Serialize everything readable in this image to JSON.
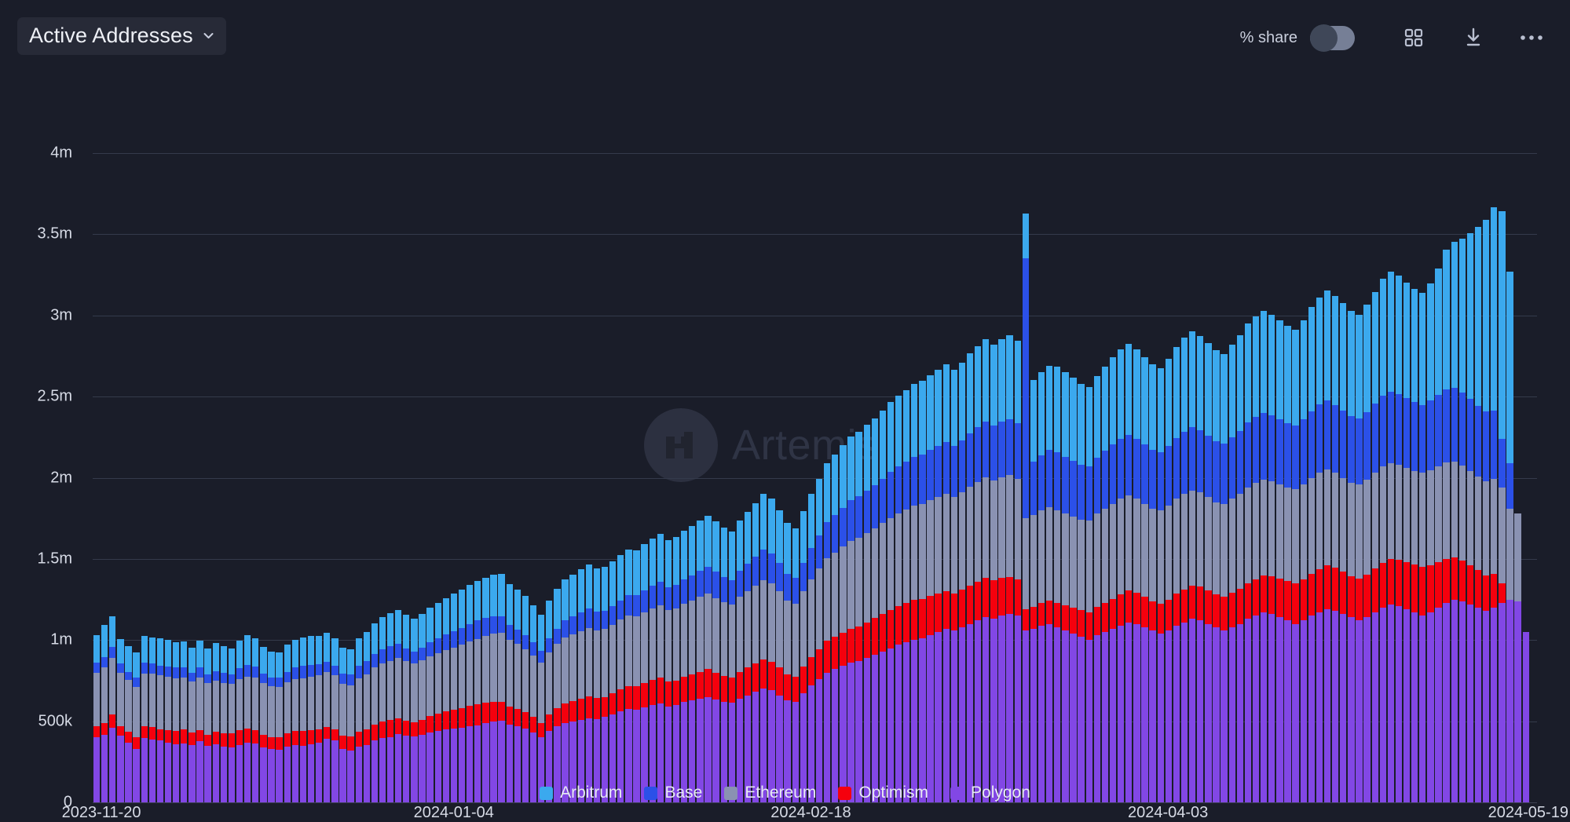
{
  "header": {
    "title": "Active Addresses",
    "dropdown_icon": "chevron-down-icon",
    "share_label": "% share",
    "toggle_state": "off",
    "grid_icon": "grid-view-icon",
    "download_icon": "download-icon",
    "more_icon": "more-options-icon"
  },
  "watermark": {
    "text": "Artemis"
  },
  "colors": {
    "background": "#1a1d29",
    "grid": "#343a4b",
    "text": "#d7dbe6",
    "Arbitrum": "#3ba9ee",
    "Base": "#2b50e8",
    "Ethereum": "#8a92b2",
    "Optimism": "#f5000d",
    "Polygon": "#8247e5"
  },
  "chart_data": {
    "type": "bar",
    "stacked": true,
    "title": "Active Addresses",
    "xlabel": "",
    "ylabel": "",
    "ylim": [
      0,
      4000000
    ],
    "grid": true,
    "legend_position": "bottom",
    "ytick_labels": [
      "0",
      "500k",
      "1m",
      "1.5m",
      "2m",
      "2.5m",
      "3m",
      "3.5m",
      "4m"
    ],
    "ytick_values": [
      0,
      500000,
      1000000,
      1500000,
      2000000,
      2500000,
      3000000,
      3500000,
      4000000
    ],
    "xtick_labels": [
      "2023-11-20",
      "2024-01-04",
      "2024-02-18",
      "2024-04-03",
      "2024-05-19"
    ],
    "xtick_indices": [
      0,
      45,
      90,
      135,
      181
    ],
    "x_start": "2023-11-20",
    "x_end": "2024-05-19",
    "n_points": 182,
    "series": [
      {
        "name": "Polygon",
        "color": "#8247e5",
        "values": [
          400000,
          415000,
          460000,
          410000,
          370000,
          330000,
          395000,
          385000,
          380000,
          370000,
          360000,
          365000,
          355000,
          375000,
          350000,
          360000,
          345000,
          340000,
          355000,
          370000,
          365000,
          340000,
          330000,
          325000,
          345000,
          355000,
          350000,
          360000,
          370000,
          390000,
          380000,
          330000,
          320000,
          345000,
          355000,
          380000,
          395000,
          400000,
          420000,
          410000,
          405000,
          415000,
          430000,
          440000,
          450000,
          455000,
          460000,
          470000,
          475000,
          490000,
          500000,
          505000,
          480000,
          470000,
          455000,
          430000,
          400000,
          440000,
          470000,
          490000,
          500000,
          510000,
          520000,
          515000,
          525000,
          540000,
          560000,
          575000,
          570000,
          585000,
          600000,
          610000,
          590000,
          600000,
          620000,
          630000,
          640000,
          650000,
          635000,
          620000,
          615000,
          640000,
          660000,
          680000,
          700000,
          690000,
          660000,
          630000,
          620000,
          670000,
          720000,
          760000,
          800000,
          820000,
          840000,
          860000,
          870000,
          890000,
          910000,
          930000,
          950000,
          970000,
          985000,
          1000000,
          1010000,
          1030000,
          1050000,
          1070000,
          1060000,
          1080000,
          1100000,
          1120000,
          1140000,
          1130000,
          1150000,
          1160000,
          1150000,
          1060000,
          1070000,
          1090000,
          1100000,
          1080000,
          1060000,
          1040000,
          1020000,
          1000000,
          1030000,
          1050000,
          1070000,
          1090000,
          1110000,
          1100000,
          1080000,
          1060000,
          1040000,
          1060000,
          1090000,
          1110000,
          1130000,
          1120000,
          1100000,
          1080000,
          1060000,
          1080000,
          1100000,
          1130000,
          1150000,
          1170000,
          1160000,
          1140000,
          1120000,
          1100000,
          1120000,
          1150000,
          1170000,
          1190000,
          1180000,
          1160000,
          1140000,
          1120000,
          1140000,
          1170000,
          1200000,
          1220000,
          1210000,
          1190000,
          1170000,
          1150000,
          1170000,
          1200000,
          1230000,
          1250000,
          1240000,
          1220000,
          1200000,
          1180000,
          1200000,
          1230000,
          1250000,
          1240000,
          1050000
        ]
      },
      {
        "name": "Optimism",
        "color": "#f5000d",
        "values": [
          70000,
          75000,
          80000,
          60000,
          65000,
          70000,
          75000,
          80000,
          70000,
          75000,
          80000,
          85000,
          75000,
          70000,
          65000,
          75000,
          80000,
          85000,
          90000,
          85000,
          80000,
          75000,
          70000,
          75000,
          80000,
          85000,
          90000,
          85000,
          80000,
          75000,
          70000,
          80000,
          85000,
          90000,
          95000,
          100000,
          105000,
          110000,
          100000,
          95000,
          90000,
          95000,
          100000,
          105000,
          110000,
          115000,
          120000,
          125000,
          130000,
          125000,
          120000,
          115000,
          110000,
          105000,
          100000,
          95000,
          90000,
          100000,
          110000,
          120000,
          125000,
          130000,
          135000,
          130000,
          125000,
          130000,
          135000,
          140000,
          145000,
          150000,
          155000,
          160000,
          155000,
          150000,
          155000,
          160000,
          165000,
          170000,
          165000,
          160000,
          155000,
          165000,
          170000,
          175000,
          180000,
          175000,
          170000,
          160000,
          155000,
          165000,
          175000,
          185000,
          195000,
          200000,
          205000,
          210000,
          215000,
          220000,
          225000,
          230000,
          235000,
          240000,
          245000,
          250000,
          245000,
          240000,
          235000,
          230000,
          225000,
          230000,
          235000,
          240000,
          245000,
          240000,
          235000,
          230000,
          225000,
          130000,
          135000,
          140000,
          145000,
          150000,
          155000,
          160000,
          165000,
          170000,
          175000,
          180000,
          185000,
          190000,
          195000,
          190000,
          185000,
          180000,
          185000,
          190000,
          195000,
          200000,
          205000,
          210000,
          205000,
          200000,
          205000,
          210000,
          215000,
          220000,
          225000,
          230000,
          235000,
          240000,
          245000,
          250000,
          255000,
          260000,
          265000,
          270000,
          265000,
          260000,
          255000,
          260000,
          265000,
          270000,
          275000,
          280000,
          285000,
          290000,
          295000,
          300000,
          290000,
          280000,
          270000,
          260000,
          250000,
          240000,
          230000,
          220000,
          210000,
          120000
        ]
      },
      {
        "name": "Ethereum",
        "color": "#8a92b2",
        "values": [
          330000,
          340000,
          350000,
          330000,
          320000,
          310000,
          325000,
          330000,
          335000,
          330000,
          325000,
          320000,
          315000,
          325000,
          320000,
          315000,
          310000,
          305000,
          315000,
          320000,
          325000,
          320000,
          315000,
          310000,
          315000,
          320000,
          325000,
          330000,
          335000,
          340000,
          335000,
          320000,
          315000,
          330000,
          340000,
          350000,
          355000,
          360000,
          370000,
          365000,
          360000,
          365000,
          370000,
          375000,
          380000,
          385000,
          390000,
          395000,
          400000,
          410000,
          420000,
          425000,
          410000,
          400000,
          390000,
          380000,
          370000,
          385000,
          395000,
          405000,
          410000,
          415000,
          420000,
          415000,
          420000,
          425000,
          430000,
          435000,
          430000,
          435000,
          440000,
          445000,
          440000,
          445000,
          450000,
          455000,
          460000,
          465000,
          460000,
          455000,
          450000,
          460000,
          470000,
          480000,
          490000,
          485000,
          470000,
          455000,
          450000,
          465000,
          480000,
          495000,
          510000,
          520000,
          530000,
          540000,
          545000,
          550000,
          555000,
          560000,
          565000,
          570000,
          575000,
          580000,
          585000,
          590000,
          595000,
          600000,
          595000,
          600000,
          610000,
          615000,
          620000,
          615000,
          620000,
          625000,
          620000,
          560000,
          565000,
          570000,
          575000,
          570000,
          565000,
          560000,
          555000,
          565000,
          575000,
          580000,
          585000,
          590000,
          585000,
          580000,
          575000,
          570000,
          575000,
          580000,
          585000,
          590000,
          585000,
          580000,
          575000,
          570000,
          575000,
          580000,
          585000,
          590000,
          595000,
          590000,
          585000,
          580000,
          575000,
          580000,
          585000,
          590000,
          595000,
          590000,
          585000,
          580000,
          575000,
          580000,
          585000,
          590000,
          595000,
          590000,
          585000,
          580000,
          575000,
          580000,
          585000,
          590000,
          595000,
          590000,
          585000,
          580000,
          575000,
          580000,
          585000,
          590000,
          560000,
          540000
        ]
      },
      {
        "name": "Base",
        "color": "#2b50e8",
        "values": [
          60000,
          65000,
          70000,
          55000,
          50000,
          60000,
          65000,
          60000,
          55000,
          60000,
          65000,
          60000,
          55000,
          60000,
          55000,
          60000,
          65000,
          60000,
          65000,
          70000,
          65000,
          60000,
          55000,
          60000,
          65000,
          70000,
          75000,
          70000,
          65000,
          60000,
          55000,
          65000,
          70000,
          75000,
          80000,
          85000,
          90000,
          95000,
          85000,
          80000,
          75000,
          80000,
          85000,
          90000,
          95000,
          100000,
          105000,
          110000,
          115000,
          110000,
          105000,
          100000,
          95000,
          90000,
          85000,
          80000,
          75000,
          85000,
          95000,
          105000,
          110000,
          115000,
          120000,
          115000,
          110000,
          115000,
          120000,
          125000,
          130000,
          135000,
          140000,
          145000,
          140000,
          145000,
          150000,
          155000,
          160000,
          165000,
          160000,
          155000,
          150000,
          160000,
          170000,
          180000,
          190000,
          185000,
          175000,
          165000,
          160000,
          175000,
          190000,
          205000,
          220000,
          230000,
          240000,
          250000,
          255000,
          260000,
          265000,
          275000,
          285000,
          290000,
          295000,
          300000,
          305000,
          310000,
          315000,
          320000,
          315000,
          320000,
          330000,
          335000,
          340000,
          335000,
          340000,
          345000,
          340000,
          1600000,
          330000,
          340000,
          350000,
          355000,
          350000,
          345000,
          340000,
          335000,
          345000,
          355000,
          365000,
          370000,
          375000,
          370000,
          365000,
          360000,
          355000,
          365000,
          375000,
          385000,
          390000,
          385000,
          380000,
          375000,
          370000,
          380000,
          390000,
          400000,
          405000,
          410000,
          405000,
          400000,
          395000,
          390000,
          400000,
          410000,
          420000,
          425000,
          420000,
          415000,
          410000,
          405000,
          415000,
          425000,
          435000,
          440000,
          435000,
          430000,
          425000,
          420000,
          430000,
          440000,
          450000,
          455000,
          450000,
          445000,
          440000,
          430000,
          420000,
          300000,
          280000
        ]
      },
      {
        "name": "Arbitrum",
        "color": "#3ba9ee",
        "values": [
          170000,
          200000,
          185000,
          150000,
          160000,
          155000,
          165000,
          160000,
          170000,
          165000,
          155000,
          160000,
          155000,
          165000,
          160000,
          170000,
          165000,
          160000,
          170000,
          185000,
          175000,
          165000,
          160000,
          155000,
          165000,
          170000,
          175000,
          180000,
          175000,
          180000,
          170000,
          160000,
          155000,
          170000,
          180000,
          190000,
          195000,
          200000,
          210000,
          205000,
          200000,
          205000,
          215000,
          220000,
          225000,
          230000,
          235000,
          240000,
          245000,
          250000,
          260000,
          265000,
          250000,
          245000,
          240000,
          230000,
          220000,
          235000,
          245000,
          255000,
          260000,
          265000,
          270000,
          265000,
          270000,
          275000,
          280000,
          285000,
          280000,
          285000,
          290000,
          295000,
          290000,
          295000,
          300000,
          305000,
          310000,
          315000,
          310000,
          305000,
          300000,
          310000,
          320000,
          330000,
          340000,
          335000,
          325000,
          310000,
          305000,
          320000,
          335000,
          350000,
          365000,
          375000,
          385000,
          395000,
          400000,
          405000,
          410000,
          420000,
          430000,
          435000,
          440000,
          450000,
          455000,
          460000,
          470000,
          480000,
          470000,
          480000,
          490000,
          500000,
          510000,
          500000,
          510000,
          520000,
          510000,
          280000,
          500000,
          510000,
          520000,
          530000,
          520000,
          510000,
          500000,
          490000,
          500000,
          520000,
          540000,
          550000,
          560000,
          550000,
          540000,
          530000,
          520000,
          540000,
          560000,
          580000,
          590000,
          580000,
          570000,
          560000,
          550000,
          570000,
          590000,
          610000,
          620000,
          630000,
          620000,
          610000,
          600000,
          590000,
          610000,
          640000,
          660000,
          680000,
          670000,
          660000,
          650000,
          640000,
          660000,
          690000,
          720000,
          740000,
          730000,
          710000,
          700000,
          690000,
          720000,
          780000,
          860000,
          900000,
          950000,
          1020000,
          1100000,
          1180000,
          1250000,
          1400000,
          1180000
        ]
      }
    ]
  },
  "legend": [
    {
      "label": "Arbitrum",
      "color": "#3ba9ee"
    },
    {
      "label": "Base",
      "color": "#2b50e8"
    },
    {
      "label": "Ethereum",
      "color": "#8a92b2"
    },
    {
      "label": "Optimism",
      "color": "#f5000d"
    },
    {
      "label": "Polygon",
      "color": "#8247e5"
    }
  ]
}
